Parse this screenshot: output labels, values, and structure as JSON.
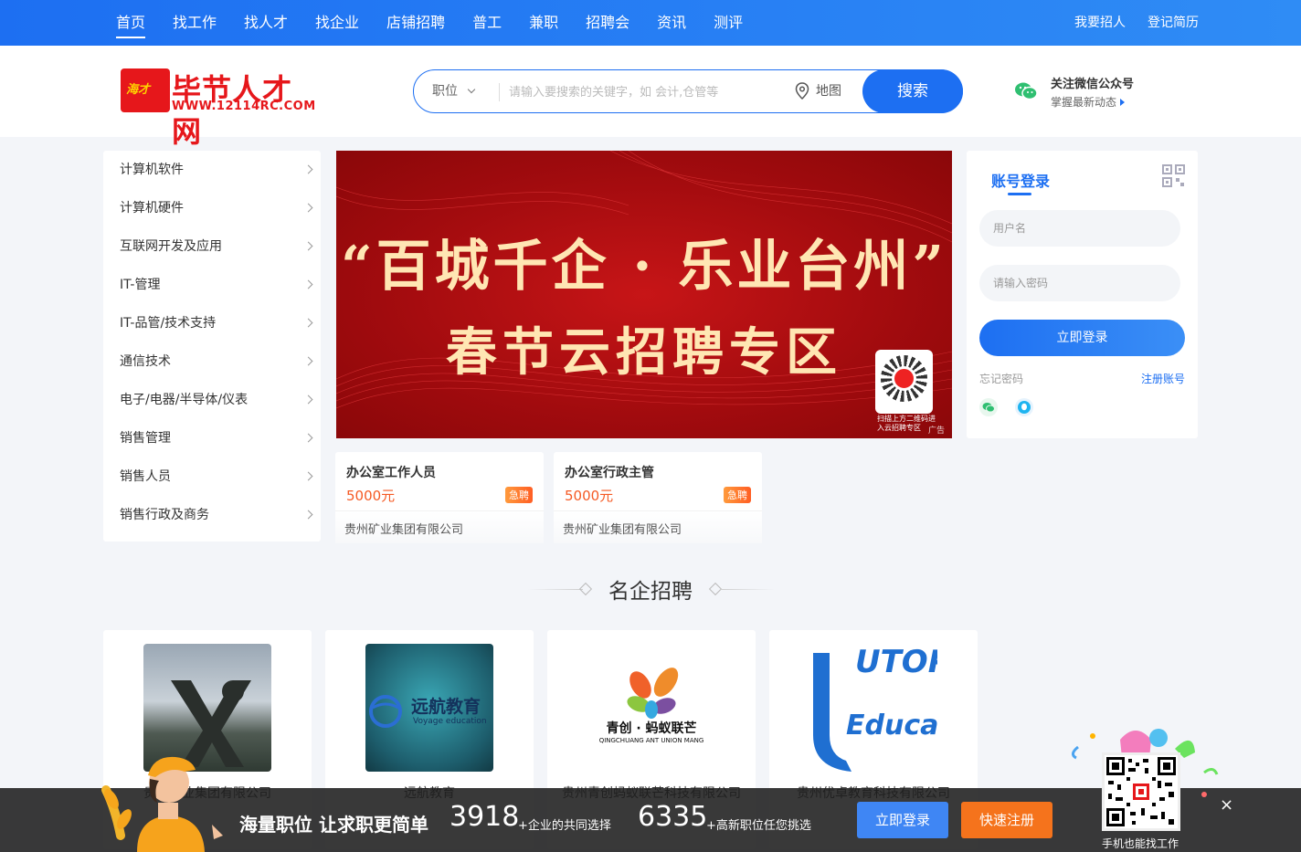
{
  "topnav": {
    "items": [
      "首页",
      "找工作",
      "找人才",
      "找企业",
      "店铺招聘",
      "普工",
      "兼职",
      "招聘会",
      "资讯",
      "测评"
    ],
    "links": [
      "我要招人",
      "登记简历"
    ]
  },
  "logo": {
    "badge": "海才",
    "title": "毕节人才网",
    "url": "WWW.12114RC.COM"
  },
  "search": {
    "category": "职位",
    "placeholder": "请输入要搜索的关键字，如 会计,仓管等",
    "map_label": "地图",
    "button": "搜索"
  },
  "wechat": {
    "title": "关注微信公众号",
    "subtitle": "掌握最新动态"
  },
  "categories": [
    "计算机软件",
    "计算机硬件",
    "互联网开发及应用",
    "IT-管理",
    "IT-品管/技术支持",
    "通信技术",
    "电子/电器/半导体/仪表",
    "销售管理",
    "销售人员",
    "销售行政及商务"
  ],
  "banner": {
    "line1": "“百城千企 · 乐业台州”",
    "line2": "春节云招聘专区",
    "qr_text": "扫描上方二维码进入云招聘专区",
    "ad_label": "广告"
  },
  "jobs": [
    {
      "title": "办公室工作人员",
      "salary": "5000元",
      "badge": "急聘",
      "company": "贵州矿业集团有限公司"
    },
    {
      "title": "办公室行政主管",
      "salary": "5000元",
      "badge": "急聘",
      "company": "贵州矿业集团有限公司"
    }
  ],
  "login": {
    "title": "账号登录",
    "username_placeholder": "用户名",
    "password_placeholder": "请输入密码",
    "button": "立即登录",
    "forgot": "忘记密码",
    "register": "注册账号"
  },
  "section": {
    "title": "名企招聘"
  },
  "companies": [
    {
      "name": "贵州矿业集团有限公司",
      "logo_text": ""
    },
    {
      "name": "远航教育",
      "logo_text": "远航教育",
      "logo_sub": "Voyage education"
    },
    {
      "name": "贵州青创蚂蚁联芒科技有限公司",
      "logo_text": "青创 · 蚂蚁联芒",
      "logo_sub": "QINGCHUANG ANT UNION MANG"
    },
    {
      "name": "贵州优卓教育科技有限公司",
      "logo_text": "UTOP",
      "logo_sub": "Education"
    }
  ],
  "bottombar": {
    "slogan": "海量职位 让求职更简单",
    "num1": "3918",
    "desc1": "+企业的共同选择",
    "num2": "6335",
    "desc2": "+高新职位任您挑选",
    "login": "立即登录",
    "register": "快速注册",
    "mobile_text": "手机也能找工作",
    "close": "×"
  },
  "colors": {
    "primary": "#1d6ff2",
    "accent": "#f5731c",
    "banner_red": "#a10b0e"
  }
}
